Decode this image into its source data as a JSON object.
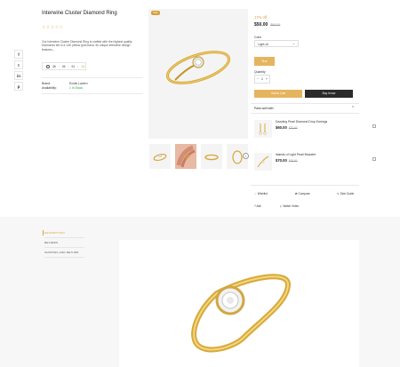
{
  "product": {
    "title": "Interwine Cluster Diamond Ring",
    "stars": "☆☆☆☆☆",
    "description": "Our Interwine Cluster Diamond Ring is crafted with the highest quality Diamonds set in a 14K yellow gold band. Its unique interwine design features...",
    "countdown": {
      "days": "36",
      "hours": "06",
      "minutes": "51",
      "seconds": "14"
    },
    "brand_label": "Brand:",
    "brand_value": "Exotic Lavern",
    "availability_label": "Availability:",
    "availability_value": "1 In Stock",
    "sale_badge": "Sale",
    "discount": "17% off",
    "price": "$50.00",
    "old_price": "$60.00",
    "color_label": "Color",
    "color_value": "Light-oil",
    "size_button": "Size",
    "quantity_label": "Quantity",
    "quantity_value": "1",
    "add_to_cart": "Add to Cart",
    "buy_now": "Buy it now"
  },
  "pairs_well": {
    "title": "Pairs well with",
    "items": [
      {
        "name": "Dazzling Pearl Diamond Drop Earrings",
        "price": "$60.00",
        "old_price": "$70.00"
      },
      {
        "name": "Islands of Light Pearl Bracelet",
        "price": "$70.00",
        "old_price": "$75.00"
      }
    ]
  },
  "actions": {
    "wishlist": "Wishlist",
    "compare": "Compare",
    "size_guide": "Size Guide",
    "ask": "Ask",
    "watch_video": "Watch Video"
  },
  "tabs": [
    "DESCRIPTION",
    "REVIEWS",
    "SHIPPING AND RETURN"
  ],
  "icons": {
    "social": [
      "facebook-icon",
      "twitter-icon",
      "linkedin-icon",
      "pinterest-icon"
    ],
    "social_glyphs": [
      "f",
      "t",
      "in",
      "p"
    ]
  },
  "colors": {
    "accent": "#d4a03a",
    "add_to_cart": "#e5b45e",
    "buy_now": "#2b2b2b"
  }
}
